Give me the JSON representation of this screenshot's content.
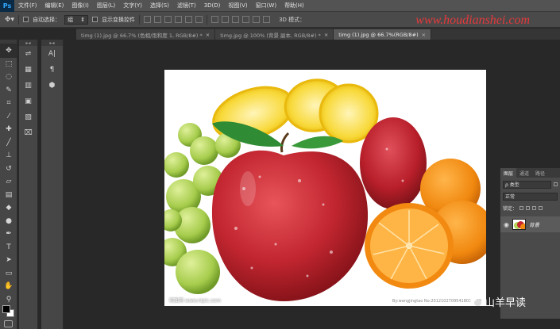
{
  "app": {
    "logo": "Ps"
  },
  "menu": [
    "文件(F)",
    "编辑(E)",
    "图像(I)",
    "图层(L)",
    "文字(Y)",
    "选择(S)",
    "滤镜(T)",
    "3D(D)",
    "视图(V)",
    "窗口(W)",
    "帮助(H)"
  ],
  "options": {
    "auto_select_label": "自动选择：",
    "auto_select_value": "组",
    "show_transform_label": "显示变换控件",
    "mode_3d": "3D 模式："
  },
  "watermark_top": "www.houdianshei.com",
  "tabs": [
    {
      "label": "timg (1).jpg @ 66.7% (色相/饱和度 1, RGB/8#) *",
      "active": false
    },
    {
      "label": "timg.jpg @ 100% (背景 副本, RGB/8#) *",
      "active": false
    },
    {
      "label": "timg (1).jpg @ 66.7%(RGB/8#)",
      "active": true
    }
  ],
  "tools": [
    {
      "icon": "move-icon",
      "glyph": "✥"
    },
    {
      "icon": "marquee-icon",
      "glyph": "⬚"
    },
    {
      "icon": "lasso-icon",
      "glyph": "◌"
    },
    {
      "icon": "quick-select-icon",
      "glyph": "✎"
    },
    {
      "icon": "crop-icon",
      "glyph": "⌗"
    },
    {
      "icon": "eyedropper-icon",
      "glyph": "⁄"
    },
    {
      "icon": "healing-icon",
      "glyph": "✚"
    },
    {
      "icon": "brush-icon",
      "glyph": "╱"
    },
    {
      "icon": "stamp-icon",
      "glyph": "⊥"
    },
    {
      "icon": "history-brush-icon",
      "glyph": "↺"
    },
    {
      "icon": "eraser-icon",
      "glyph": "▱"
    },
    {
      "icon": "gradient-icon",
      "glyph": "▤"
    },
    {
      "icon": "blur-icon",
      "glyph": "◆"
    },
    {
      "icon": "dodge-icon",
      "glyph": "●"
    },
    {
      "icon": "pen-icon",
      "glyph": "✒"
    },
    {
      "icon": "type-icon",
      "glyph": "T"
    },
    {
      "icon": "path-select-icon",
      "glyph": "➤"
    },
    {
      "icon": "shape-icon",
      "glyph": "▭"
    },
    {
      "icon": "hand-icon",
      "glyph": "✋"
    },
    {
      "icon": "zoom-icon",
      "glyph": "⚲"
    }
  ],
  "panel_strip_1": [
    "⇌",
    "▦",
    "▥",
    "▣",
    "▧",
    "⌧"
  ],
  "panel_strip_2": [
    "A|",
    "¶",
    "⬢"
  ],
  "layers_panel": {
    "tabs": [
      "图层",
      "通道",
      "路径"
    ],
    "filter_label": "ρ 类型",
    "blend_mode": "正常",
    "lock_label": "锁定：",
    "layer_name": "背景"
  },
  "photo_credit_left": "昵图网 www.nipic.com",
  "photo_credit_right": "By:wangjingtao No:20121027095418031000",
  "wechat_watermark": "山羊早读",
  "colors": {
    "accent": "#31a8ff",
    "watermark_red": "#e4393c",
    "apple_red": "#c8262e",
    "orange": "#f28a12",
    "grape": "#a9cf4f",
    "lemon": "#f6d32a"
  }
}
